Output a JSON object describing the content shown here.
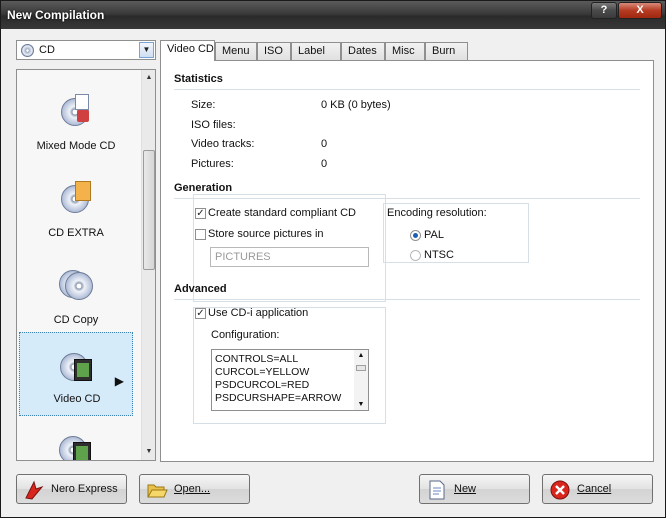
{
  "window": {
    "title": "New Compilation",
    "help_label": "?",
    "close_label": "X"
  },
  "media_selector": {
    "value": "CD",
    "icon": "cd-disc-icon"
  },
  "compilation_types": [
    {
      "label": "Mixed Mode CD",
      "icon": "mixed-mode-cd-icon"
    },
    {
      "label": "CD EXTRA",
      "icon": "cd-extra-icon"
    },
    {
      "label": "CD Copy",
      "icon": "cd-copy-icon"
    },
    {
      "label": "Video CD",
      "icon": "video-cd-icon",
      "selected": true
    },
    {
      "label": "",
      "icon": "video-film-icon"
    }
  ],
  "tabs": [
    "Video CD",
    "Menu",
    "ISO",
    "Label",
    "Dates",
    "Misc",
    "Burn"
  ],
  "active_tab": "Video CD",
  "statistics": {
    "title": "Statistics",
    "rows": [
      {
        "label": "Size:",
        "value": "0 KB (0 bytes)"
      },
      {
        "label": "ISO files:",
        "value": ""
      },
      {
        "label": "Video tracks:",
        "value": "0"
      },
      {
        "label": "Pictures:",
        "value": "0"
      }
    ]
  },
  "generation": {
    "title": "Generation",
    "compliant_label": "Create standard compliant CD",
    "compliant_checked": true,
    "store_pictures_label": "Store source pictures in",
    "store_pictures_checked": false,
    "pictures_folder_placeholder": "PICTURES",
    "encoding_label": "Encoding resolution:",
    "pal_label": "PAL",
    "ntsc_label": "NTSC",
    "selected_resolution": "PAL"
  },
  "advanced": {
    "title": "Advanced",
    "cdi_label": "Use CD-i application",
    "cdi_checked": true,
    "config_label": "Configuration:",
    "config_lines": [
      "CONTROLS=ALL",
      "CURCOL=YELLOW",
      "PSDCURCOL=RED",
      "PSDCURSHAPE=ARROW"
    ]
  },
  "buttons": {
    "nero_express": "Nero Express",
    "open": "Open...",
    "new": "New",
    "cancel": "Cancel"
  },
  "check_mark": "✓",
  "scroll_up": "▲",
  "scroll_down": "▼",
  "submenu_arrow": "▶",
  "colors": {
    "selection": "#d6ebfa",
    "accent": "#1a5fb4",
    "cancel_red": "#d9261c"
  }
}
